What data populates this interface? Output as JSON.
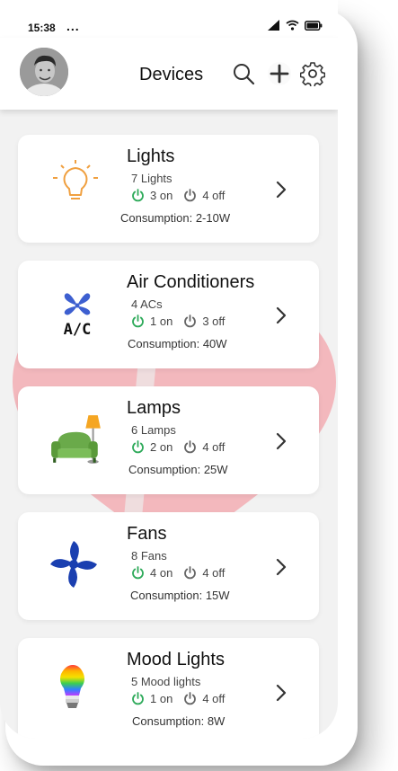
{
  "status_bar": {
    "time": "15:38",
    "dots": "..."
  },
  "header": {
    "title": "Devices"
  },
  "devices": [
    {
      "name": "Lights",
      "count": "7 Lights",
      "on": "3 on",
      "off": "4 off",
      "consumption": "Consumption: 2-10W",
      "icon": "lightbulb-icon"
    },
    {
      "name": "Air Conditioners",
      "count": "4 ACs",
      "on": "1 on",
      "off": "3 off",
      "consumption": "Consumption: 40W",
      "icon": "ac-icon"
    },
    {
      "name": "Lamps",
      "count": "6 Lamps",
      "on": "2 on",
      "off": "4 off",
      "consumption": "Consumption: 25W",
      "icon": "lamp-sofa-icon"
    },
    {
      "name": "Fans",
      "count": "8 Fans",
      "on": "4 on",
      "off": "4 off",
      "consumption": "Consumption: 15W",
      "icon": "fan-icon"
    },
    {
      "name": "Mood Lights",
      "count": "5 Mood lights",
      "on": "1 on",
      "off": "4 off",
      "consumption": "Consumption: 8W",
      "icon": "rainbow-bulb-icon"
    }
  ],
  "colors": {
    "on": "#2eaa5a",
    "off": "#666666",
    "light_orange": "#f0a040",
    "fan_blue": "#1a3fb0",
    "sofa_green": "#5a9a3a"
  }
}
